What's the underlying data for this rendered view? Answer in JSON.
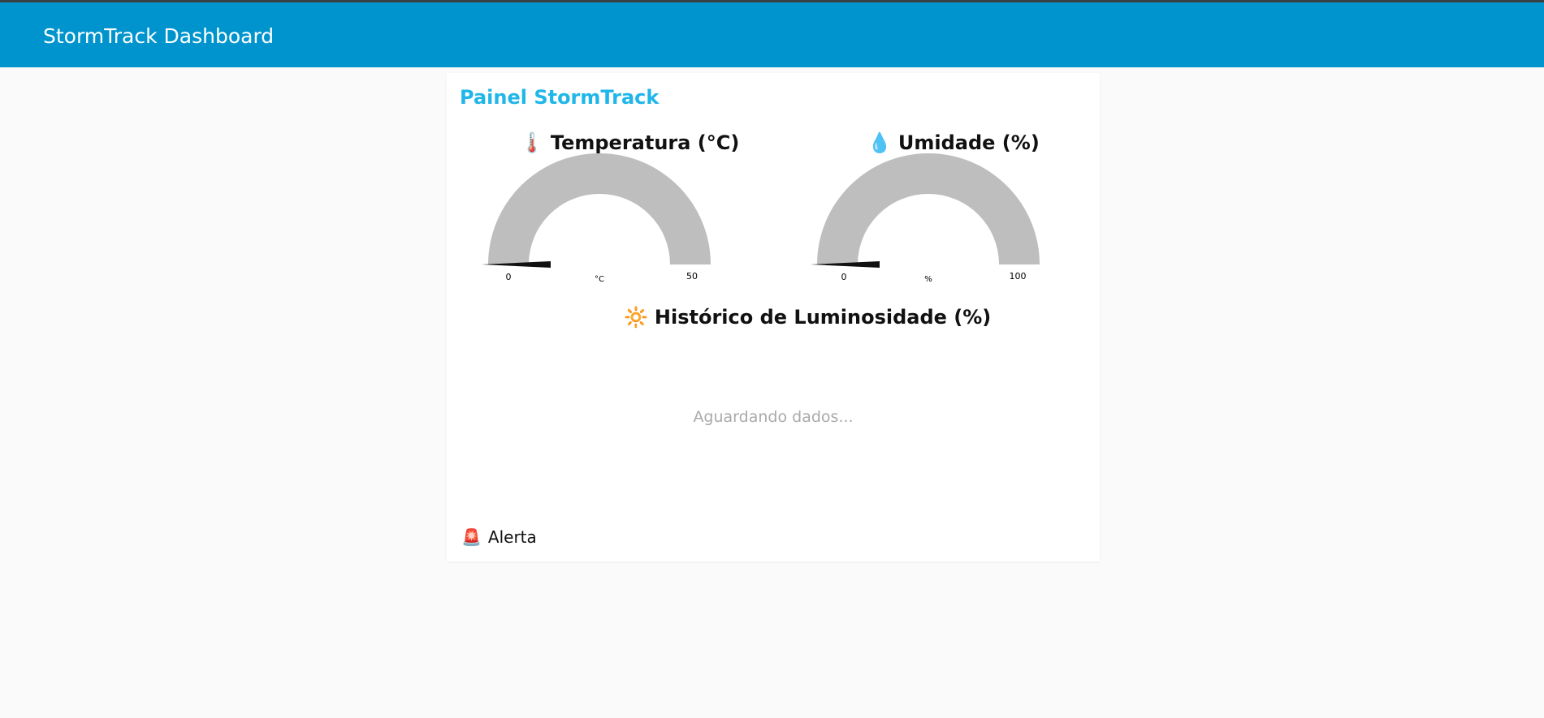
{
  "header": {
    "title": "StormTrack Dashboard"
  },
  "panel": {
    "title": "Painel StormTrack",
    "temperature": {
      "icon": "thermometer-icon",
      "icon_glyph": "🌡️",
      "title": "Temperatura (°C)",
      "min_label": "0",
      "max_label": "50",
      "unit": "°C",
      "value_fraction": 0
    },
    "humidity": {
      "icon": "droplet-icon",
      "icon_glyph": "💧",
      "title": "Umidade (%)",
      "min_label": "0",
      "max_label": "100",
      "unit": "%",
      "value_fraction": 0
    },
    "luminosity": {
      "icon": "sun-icon",
      "icon_glyph": "🔆",
      "title": "Histórico de Luminosidade (%)",
      "waiting_text": "Aguardando dados..."
    },
    "alert": {
      "icon": "siren-icon",
      "icon_glyph": "🚨",
      "label": "Alerta"
    }
  },
  "colors": {
    "header_bg": "#0094ce",
    "panel_title": "#1fb6e9",
    "gauge_track": "#bebebe",
    "needle": "#111111"
  }
}
